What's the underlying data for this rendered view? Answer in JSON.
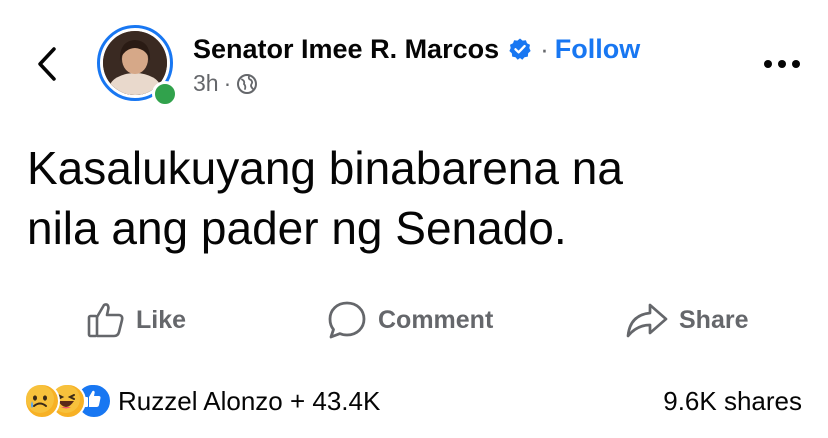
{
  "header": {
    "author_name": "Senator Imee R. Marcos",
    "dot_separator": "·",
    "follow_label": "Follow",
    "time": "3h",
    "meta_separator": "·",
    "privacy_icon": "globe-icon",
    "back_icon": "chevron-left-icon",
    "more_icon": "more-horizontal-icon"
  },
  "post": {
    "line1": "Kasalukuyang binabarena na",
    "line2": "nila ang pader ng Senado."
  },
  "actions": {
    "like_label": "Like",
    "comment_label": "Comment",
    "share_label": "Share"
  },
  "footer": {
    "reaction_summary": "Ruzzel Alonzo + 43.4K",
    "shares": "9.6K shares",
    "reaction_icons": [
      "sad-reaction-icon",
      "haha-reaction-icon",
      "like-reaction-icon"
    ]
  },
  "colors": {
    "accent": "#1877f2",
    "online": "#31a24c",
    "secondary_text": "#65676b",
    "primary_text": "#050505"
  }
}
